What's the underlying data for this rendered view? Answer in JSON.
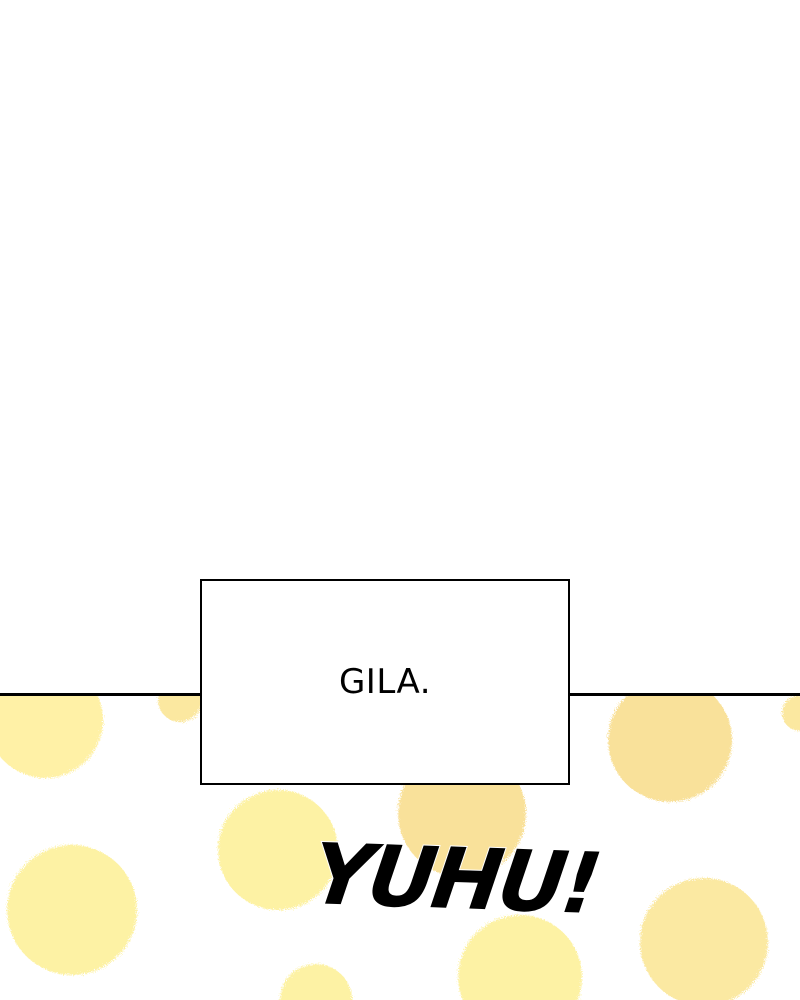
{
  "caption": {
    "text": "GILA."
  },
  "sound_effect": {
    "text": "YUHU!"
  },
  "colors": {
    "background": "#ffffff",
    "border": "#000000",
    "dot_light": "#fff3a8",
    "dot_warm": "#fae39a"
  }
}
